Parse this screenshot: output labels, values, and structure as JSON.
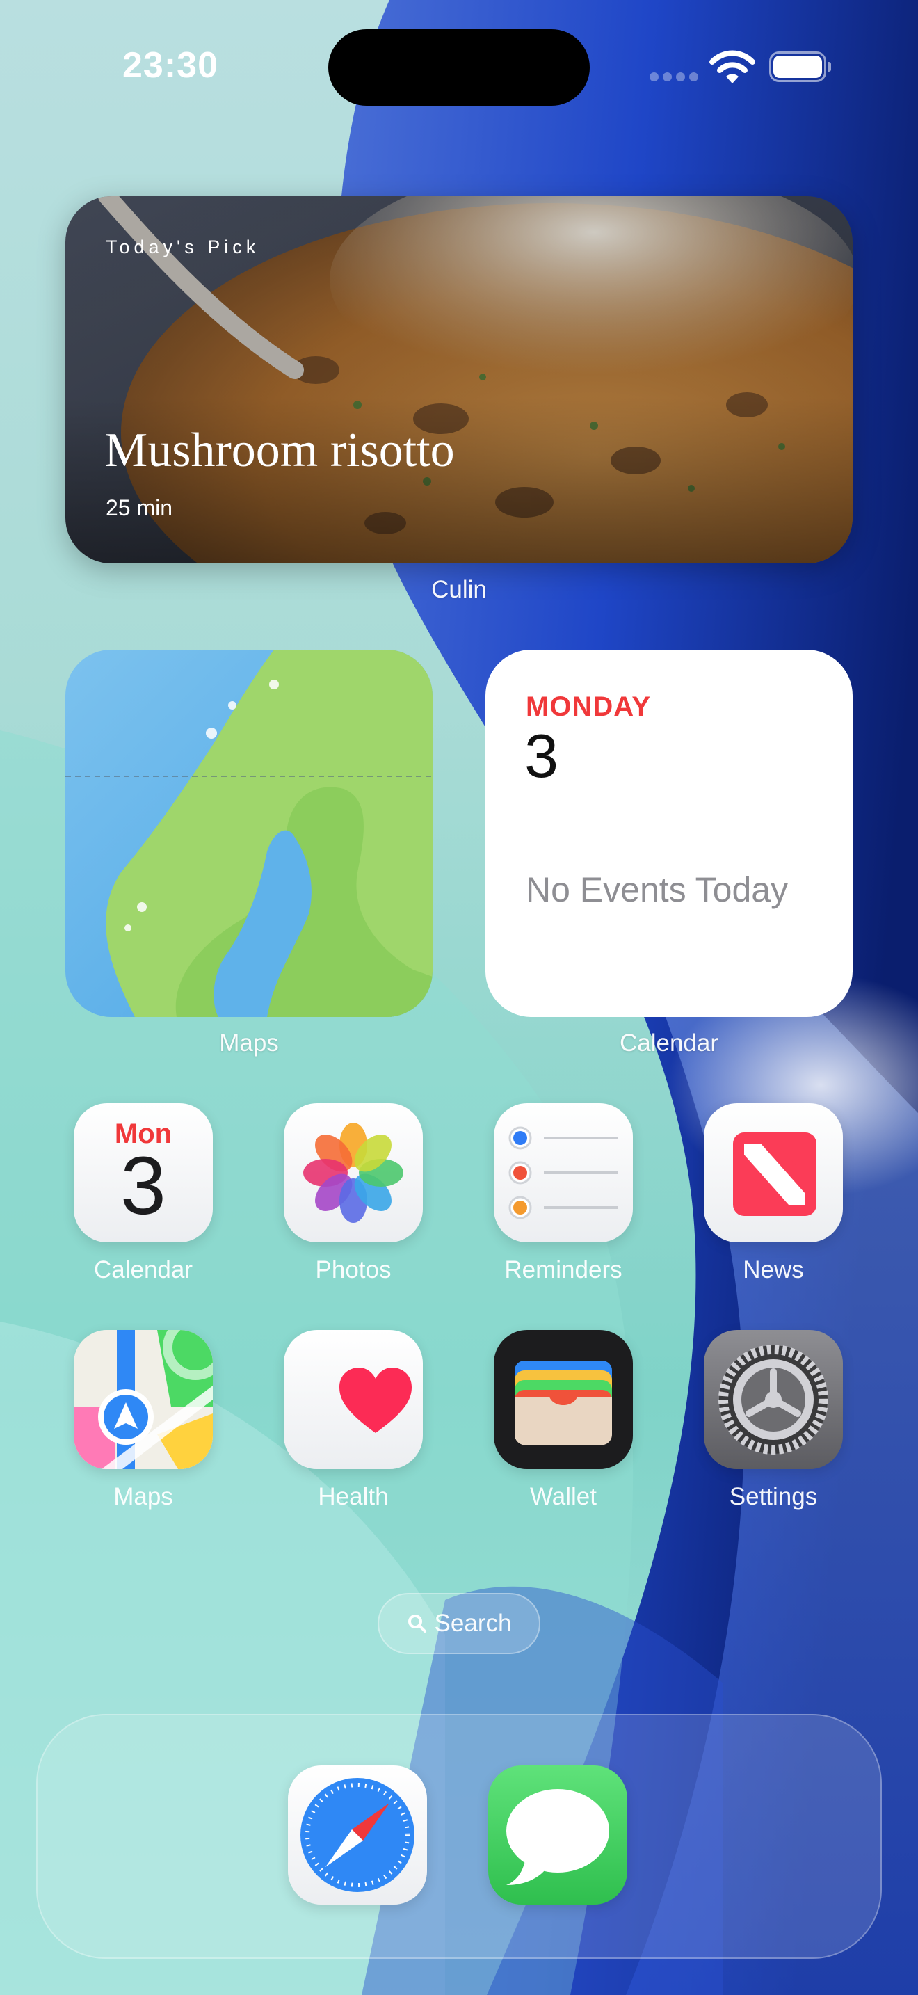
{
  "status_bar": {
    "time": "23:30"
  },
  "widgets": {
    "culin": {
      "kicker": "Today's Pick",
      "title": "Mushroom risotto",
      "subtitle": "25 min",
      "app_label": "Culin"
    },
    "maps": {
      "app_label": "Maps"
    },
    "calendar": {
      "weekday": "MONDAY",
      "day": "3",
      "empty_text": "No Events Today",
      "app_label": "Calendar"
    }
  },
  "apps": {
    "row1": [
      {
        "label": "Calendar",
        "icon": "calendar-icon",
        "month": "Mon",
        "day": "3"
      },
      {
        "label": "Photos",
        "icon": "photos-icon"
      },
      {
        "label": "Reminders",
        "icon": "reminders-icon"
      },
      {
        "label": "News",
        "icon": "news-icon"
      }
    ],
    "row2": [
      {
        "label": "Maps",
        "icon": "maps-icon"
      },
      {
        "label": "Health",
        "icon": "health-icon"
      },
      {
        "label": "Wallet",
        "icon": "wallet-icon"
      },
      {
        "label": "Settings",
        "icon": "settings-icon"
      }
    ]
  },
  "search": {
    "label": "Search",
    "icon": "search-icon"
  },
  "dock": {
    "apps": [
      {
        "icon": "safari-icon"
      },
      {
        "icon": "messages-icon"
      }
    ]
  },
  "colors": {
    "calendar_red": "#f0383a",
    "wallpaper_teal": "#7fd3c8",
    "wallpaper_blue": "#1f46c7",
    "messages_green": "#35c759",
    "news_red": "#fb3c57"
  }
}
